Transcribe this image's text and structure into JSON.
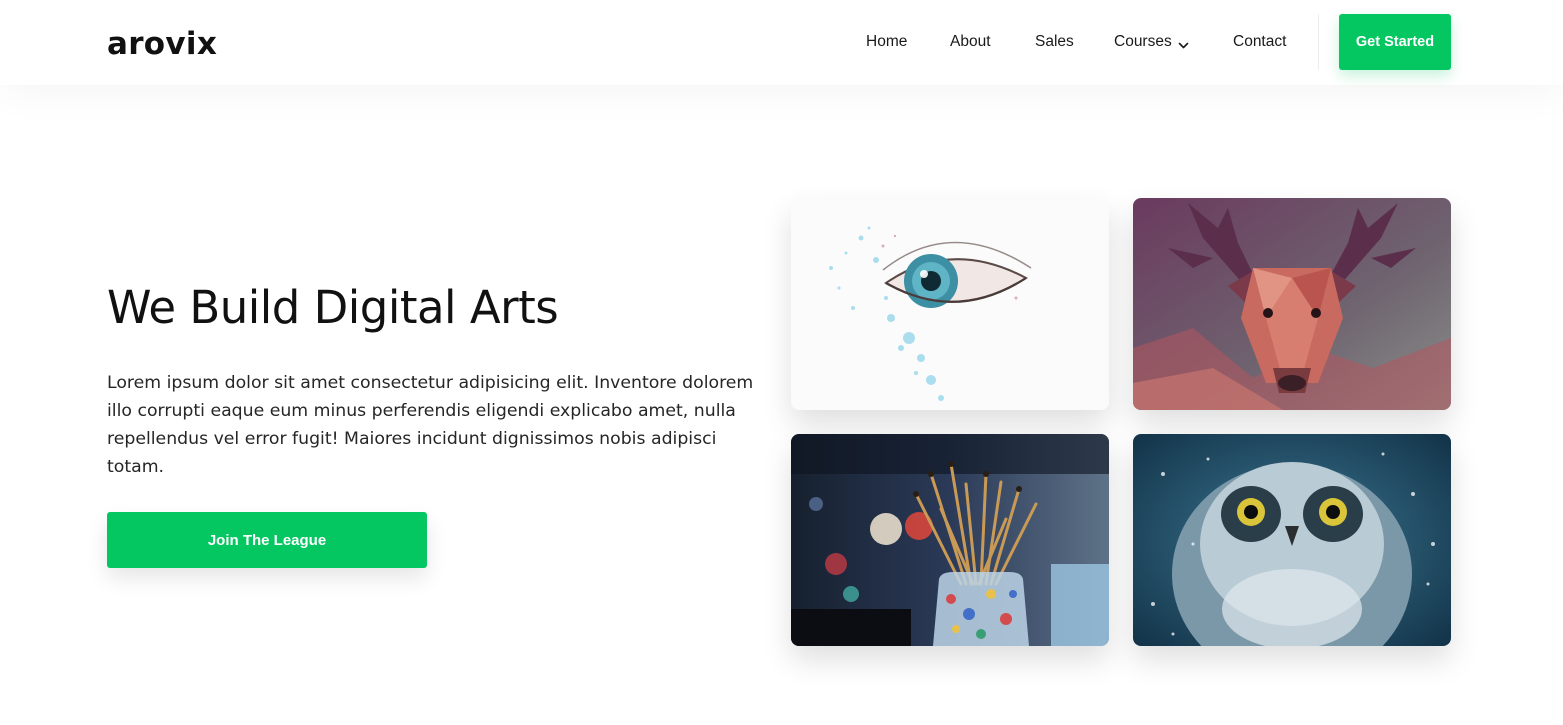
{
  "brand": {
    "logo_text": "arovix",
    "accent_color": "#04c761"
  },
  "nav": {
    "items": [
      {
        "label": "Home"
      },
      {
        "label": "About"
      },
      {
        "label": "Sales"
      },
      {
        "label": "Courses",
        "icon": "chevron-down-icon"
      },
      {
        "label": "Contact"
      }
    ],
    "cta_label": "Get Started"
  },
  "hero": {
    "title": "We Build Digital Arts",
    "description": "Lorem ipsum dolor sit amet consectetur adipisicing elit. Inventore dolorem illo corrupti eaque eum minus perferendis eligendi explicabo amet, nulla repellendus vel error fugit! Maiores incidunt dignissimos nobis adipisci totam.",
    "button_label": "Join The League"
  },
  "gallery": {
    "images": [
      {
        "subject": "watercolor eye"
      },
      {
        "subject": "low-poly deer"
      },
      {
        "subject": "paint brushes in jar"
      },
      {
        "subject": "snowy owl"
      }
    ]
  }
}
